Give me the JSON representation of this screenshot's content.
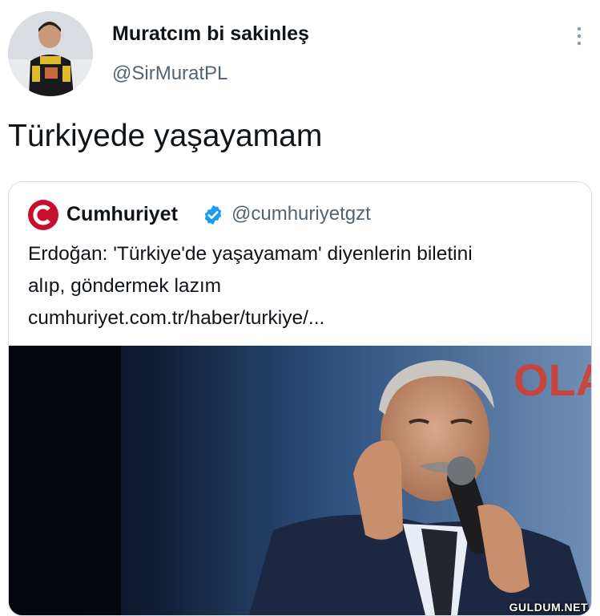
{
  "author": {
    "name": "Muratcım bi sakinleş",
    "handle": "@SirMuratPL"
  },
  "tweet": {
    "text": "Türkiyede yaşayamam"
  },
  "quoted": {
    "name": "Cumhuriyet",
    "handle": "@cumhuriyetgzt",
    "lines": [
      "Erdoğan: 'Türkiye'de yaşayamam' diyenlerin biletini",
      "alıp, göndermek lazım",
      "cumhuriyet.com.tr/haber/turkiye/..."
    ],
    "image_backdrop_text": "OLA"
  },
  "watermark": "GULDUM.NET",
  "colors": {
    "text": "#0f1419",
    "secondary": "#536471",
    "verified": "#1d9bf0",
    "logo_red": "#c8102e",
    "border": "#d6dde3"
  },
  "icons": [
    "more-vertical-icon",
    "verified-badge-icon",
    "cumhuriyet-logo-icon"
  ]
}
